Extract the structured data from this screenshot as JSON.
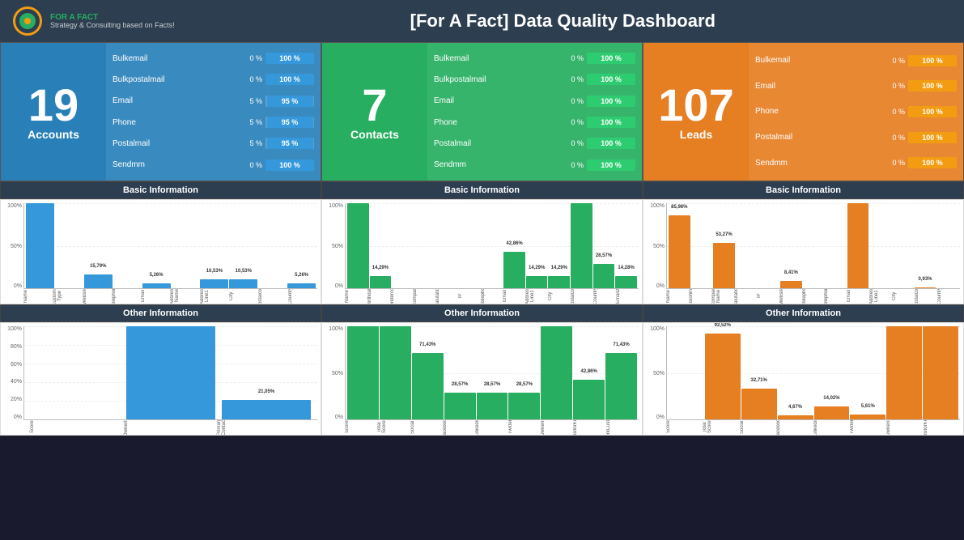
{
  "header": {
    "title": "[For A Fact] Data Quality Dashboard",
    "logo_line1": "FOR A FACT",
    "logo_line2": "Strategy & Consulting based on Facts!"
  },
  "panels": [
    {
      "id": "accounts",
      "color": "blue",
      "big_number": "19",
      "label": "Accounts",
      "metrics": [
        {
          "name": "Bulkemail",
          "pct": "0 %",
          "bar": "100 %"
        },
        {
          "name": "Bulkpostalmail",
          "pct": "0 %",
          "bar": "100 %"
        },
        {
          "name": "Email",
          "pct": "5 %",
          "bar": "95 %"
        },
        {
          "name": "Phone",
          "pct": "5 %",
          "bar": "95 %"
        },
        {
          "name": "Postalmail",
          "pct": "5 %",
          "bar": "95 %"
        },
        {
          "name": "Sendmm",
          "pct": "0 %",
          "bar": "100 %"
        }
      ]
    },
    {
      "id": "contacts",
      "color": "green",
      "big_number": "7",
      "label": "Contacts",
      "metrics": [
        {
          "name": "Bulkemail",
          "pct": "0 %",
          "bar": "100 %"
        },
        {
          "name": "Bulkpostalmail",
          "pct": "0 %",
          "bar": "100 %"
        },
        {
          "name": "Email",
          "pct": "0 %",
          "bar": "100 %"
        },
        {
          "name": "Phone",
          "pct": "0 %",
          "bar": "100 %"
        },
        {
          "name": "Postalmail",
          "pct": "0 %",
          "bar": "100 %"
        },
        {
          "name": "Sendmm",
          "pct": "0 %",
          "bar": "100 %"
        }
      ]
    },
    {
      "id": "leads",
      "color": "orange",
      "big_number": "107",
      "label": "Leads",
      "metrics": [
        {
          "name": "Bulkemail",
          "pct": "0 %",
          "bar": "100 %"
        },
        {
          "name": "Email",
          "pct": "0 %",
          "bar": "100 %"
        },
        {
          "name": "Phone",
          "pct": "0 %",
          "bar": "100 %"
        },
        {
          "name": "Postalmail",
          "pct": "0 %",
          "bar": "100 %"
        },
        {
          "name": "Sendmm",
          "pct": "0 %",
          "bar": "100 %"
        }
      ]
    }
  ],
  "basic_info": {
    "label": "Basic Information"
  },
  "other_info": {
    "label": "Other Information"
  },
  "charts": {
    "accounts_basic": {
      "bars": [
        {
          "label": "Name",
          "pct": 100,
          "value": "100%"
        },
        {
          "label": "Customer Type",
          "pct": 0,
          "value": ""
        },
        {
          "label": "Website",
          "pct": 15.79,
          "value": "15,79%"
        },
        {
          "label": "Telephone",
          "pct": 0,
          "value": ""
        },
        {
          "label": "Email",
          "pct": 5.26,
          "value": "5,26%"
        },
        {
          "label": "Address Name",
          "pct": 0,
          "value": ""
        },
        {
          "label": "Address Line1",
          "pct": 10.53,
          "value": "10,53%"
        },
        {
          "label": "City",
          "pct": 10.53,
          "value": "10,53%"
        },
        {
          "label": "Postalcode",
          "pct": 0,
          "value": ""
        },
        {
          "label": "Country",
          "pct": 5.26,
          "value": "5,26%"
        }
      ]
    },
    "accounts_other": {
      "bars": [
        {
          "label": "Score",
          "pct": 0,
          "value": ""
        },
        {
          "label": "OwnerID",
          "pct": 100,
          "value": "100,00%"
        },
        {
          "label": "Primary Contact",
          "pct": 21.05,
          "value": "21,05%"
        }
      ]
    },
    "contacts_basic": {
      "bars": [
        {
          "label": "Name",
          "pct": 100,
          "value": "100%"
        },
        {
          "label": "Birthdate",
          "pct": 14.29,
          "value": "14,29%"
        },
        {
          "label": "Gendercode",
          "pct": 0,
          "value": ""
        },
        {
          "label": "Company",
          "pct": 0,
          "value": ""
        },
        {
          "label": "Salutation",
          "pct": 0,
          "value": ""
        },
        {
          "label": "IP",
          "pct": 0,
          "value": ""
        },
        {
          "label": "Mobilephone",
          "pct": 0,
          "value": ""
        },
        {
          "label": "Email",
          "pct": 42.86,
          "value": "42,86%"
        },
        {
          "label": "Address Line1",
          "pct": 14.29,
          "value": "14,29%"
        },
        {
          "label": "City",
          "pct": 14.29,
          "value": "14,29%"
        },
        {
          "label": "Postalcode",
          "pct": 100,
          "value": "100%"
        },
        {
          "label": "Country",
          "pct": 28.57,
          "value": "28,57%"
        },
        {
          "label": "Email2",
          "pct": 14.28,
          "value": "14,28%"
        }
      ]
    },
    "contacts_other": {
      "bars": [
        {
          "label": "Score",
          "pct": 100,
          "value": "100,00%"
        },
        {
          "label": "Total Score",
          "pct": 100,
          "value": "100,00%"
        },
        {
          "label": "Social",
          "pct": 71.43,
          "value": "71,43%"
        },
        {
          "label": "Facebook",
          "pct": 28.57,
          "value": "28,57%"
        },
        {
          "label": "LinkedIn",
          "pct": 28.57,
          "value": "28,57%"
        },
        {
          "label": "Twitter",
          "pct": 28.57,
          "value": "28,57%"
        },
        {
          "label": "OwnerID",
          "pct": 100,
          "value": "100,00%"
        },
        {
          "label": "VisitorKey",
          "pct": 42.86,
          "value": "42,86%"
        },
        {
          "label": "ParentCustomer",
          "pct": 71.43,
          "value": "71,43%"
        }
      ]
    },
    "leads_basic": {
      "bars": [
        {
          "label": "Name",
          "pct": 85.98,
          "value": "85,98%"
        },
        {
          "label": "Decisionmaker",
          "pct": 0,
          "value": ""
        },
        {
          "label": "Company Name",
          "pct": 53.27,
          "value": "53,27%"
        },
        {
          "label": "Salutation",
          "pct": 0,
          "value": ""
        },
        {
          "label": "IP",
          "pct": 0,
          "value": ""
        },
        {
          "label": "Website",
          "pct": 8.41,
          "value": "8,41%"
        },
        {
          "label": "Mobilephone",
          "pct": 0,
          "value": ""
        },
        {
          "label": "Telephone",
          "pct": 0,
          "value": ""
        },
        {
          "label": "Email",
          "pct": 100,
          "value": "100,00%"
        },
        {
          "label": "Address Line1",
          "pct": 0,
          "value": ""
        },
        {
          "label": "City",
          "pct": 0,
          "value": ""
        },
        {
          "label": "Postalcode",
          "pct": 0.93,
          "value": "0,93%"
        },
        {
          "label": "Country",
          "pct": 0,
          "value": ""
        }
      ]
    },
    "leads_other": {
      "bars": [
        {
          "label": "Score",
          "pct": 0,
          "value": ""
        },
        {
          "label": "Total Score",
          "pct": 92.52,
          "value": "92,52%"
        },
        {
          "label": "Social",
          "pct": 32.71,
          "value": "32,71%"
        },
        {
          "label": "Facebook",
          "pct": 4.67,
          "value": "4,67%"
        },
        {
          "label": "LinkedIn",
          "pct": 14.02,
          "value": "14,02%"
        },
        {
          "label": "Twitter",
          "pct": 5.61,
          "value": "5,61%"
        },
        {
          "label": "OwnerID",
          "pct": 100,
          "value": "100,00%"
        },
        {
          "label": "VisitorKey",
          "pct": 100,
          "value": "100,00%"
        }
      ]
    }
  }
}
